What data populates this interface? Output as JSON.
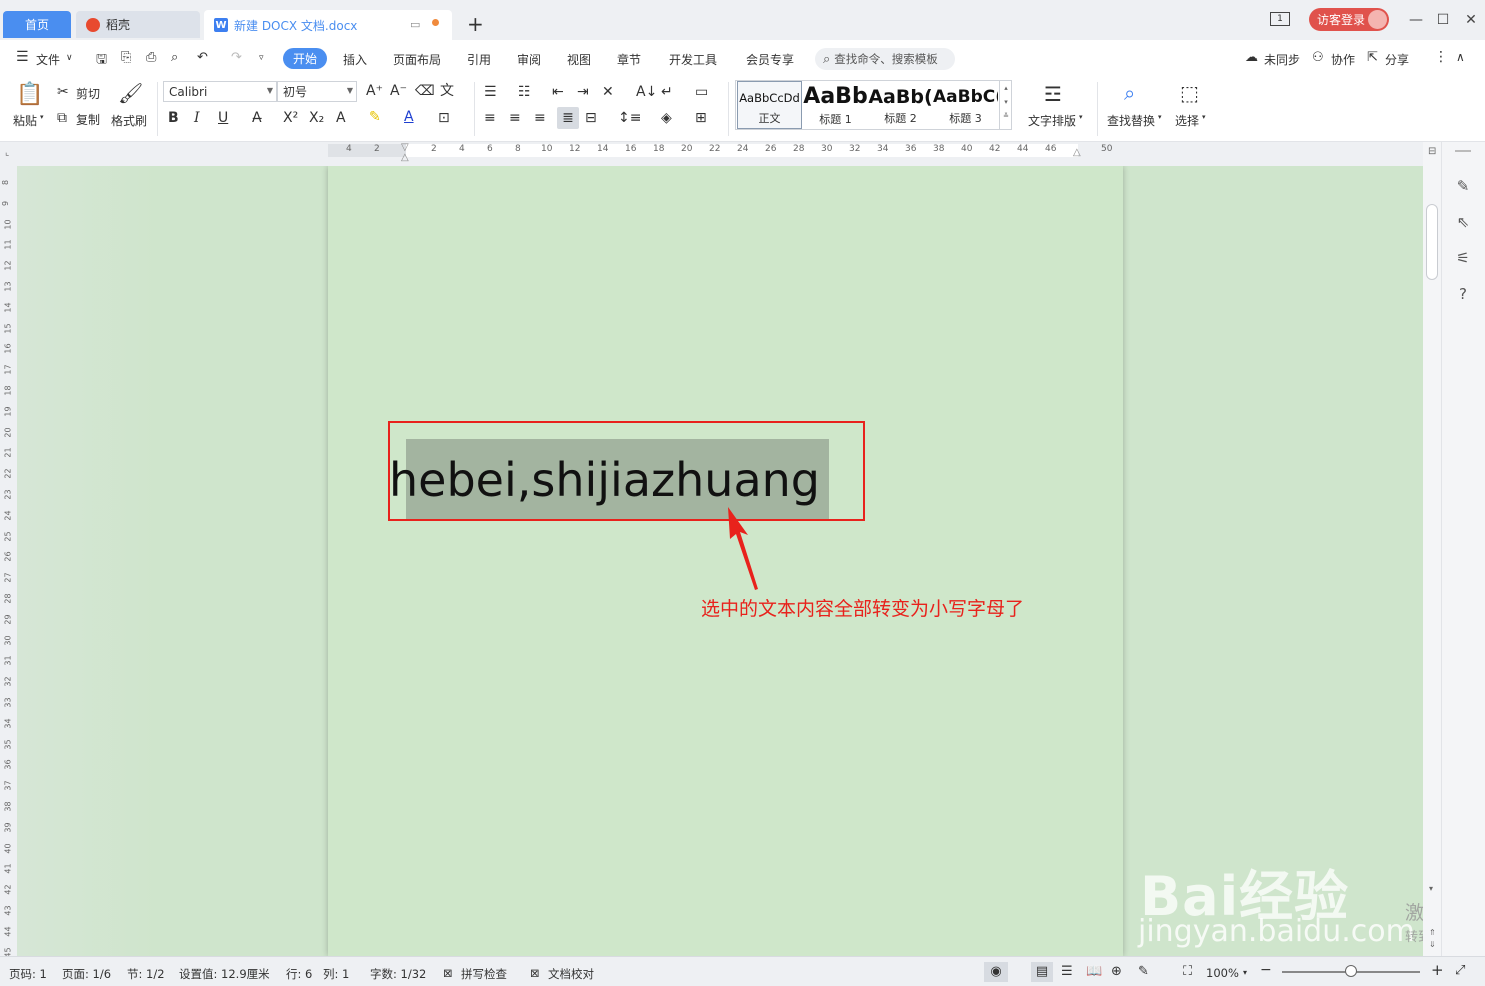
{
  "tabs": {
    "home": "首页",
    "daoke": "稻壳",
    "doc": "新建 DOCX 文档.docx"
  },
  "titlebar": {
    "login": "访客登录",
    "page_badge": "1"
  },
  "menu": {
    "file": "文件",
    "items": [
      "开始",
      "插入",
      "页面布局",
      "引用",
      "审阅",
      "视图",
      "章节",
      "开发工具",
      "会员专享"
    ],
    "search_placeholder": "查找命令、搜索模板",
    "sync": "未同步",
    "collab": "协作",
    "share": "分享"
  },
  "toolbar": {
    "paste": "粘贴",
    "cut": "剪切",
    "copy": "复制",
    "format_painter": "格式刷",
    "font_name": "Calibri",
    "font_size": "初号",
    "styles": [
      {
        "preview": "AaBbCcDd",
        "label": "正文"
      },
      {
        "preview": "AaBb",
        "label": "标题 1"
      },
      {
        "preview": "AaBb(",
        "label": "标题 2"
      },
      {
        "preview": "AaBbC(",
        "label": "标题 3"
      }
    ],
    "text_layout": "文字排版",
    "find_replace": "查找替换",
    "select": "选择"
  },
  "ruler": {
    "h_ticks": [
      "4",
      "2",
      "2",
      "4",
      "6",
      "8",
      "10",
      "12",
      "14",
      "16",
      "18",
      "20",
      "22",
      "24",
      "26",
      "28",
      "30",
      "32",
      "34",
      "36",
      "38",
      "40",
      "42",
      "44",
      "46",
      "50"
    ],
    "v_ticks": [
      "8",
      "9",
      "10",
      "11",
      "12",
      "13",
      "14",
      "15",
      "16",
      "17",
      "18",
      "19",
      "20",
      "21",
      "22",
      "23",
      "24",
      "25",
      "26",
      "27",
      "28",
      "29",
      "30",
      "31",
      "32",
      "33",
      "34",
      "35",
      "36",
      "37",
      "38",
      "39",
      "40",
      "41",
      "42",
      "43",
      "44",
      "45"
    ]
  },
  "document": {
    "text": "hebei,shijiazhuang",
    "annotation": "选中的文本内容全部转变为小写字母了"
  },
  "status": {
    "page_code": "页码: 1",
    "page": "页面: 1/6",
    "section": "节: 1/2",
    "setting": "设置值: 12.9厘米",
    "row": "行: 6",
    "col": "列: 1",
    "words": "字数: 1/32",
    "spell": "拼写检查",
    "proof": "文档校对",
    "zoom": "100%"
  },
  "watermark": {
    "brand": "Bai经验",
    "url": "jingyan.baidu.com",
    "activate": "激活 Win",
    "activate_sub": "转到\"设置\"以"
  },
  "colors": {
    "accent": "#4a8ef0",
    "annotation_red": "#e8221c",
    "selection": "#a3b4a0",
    "page_bg": "#cfe7ca"
  }
}
